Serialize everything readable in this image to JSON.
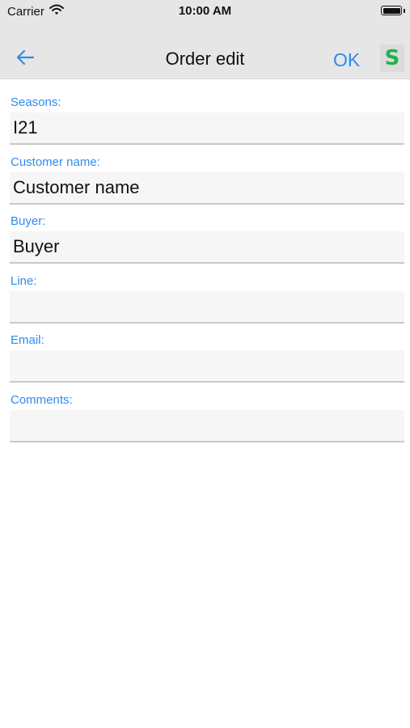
{
  "status_bar": {
    "carrier": "Carrier",
    "time": "10:00 AM",
    "battery_level": 1.0
  },
  "nav": {
    "back_icon": "back-arrow-icon",
    "title": "Order edit",
    "ok_label": "OK",
    "logo_letter": "S",
    "accent_color": "#2f8bf0",
    "logo_color": "#1fb34b"
  },
  "form": {
    "fields": [
      {
        "label": "Seasons:",
        "value": "I21"
      },
      {
        "label": "Customer name:",
        "value": "Customer name"
      },
      {
        "label": "Buyer:",
        "value": "Buyer"
      },
      {
        "label": "Line:",
        "value": ""
      },
      {
        "label": "Email:",
        "value": ""
      },
      {
        "label": "Comments:",
        "value": ""
      }
    ]
  }
}
